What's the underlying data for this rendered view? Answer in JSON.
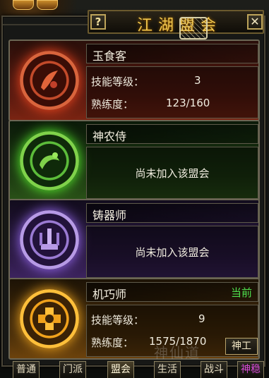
{
  "window": {
    "title": "江湖盟会",
    "help_label": "?",
    "close_label": "✕"
  },
  "guilds": [
    {
      "name": "玉食客",
      "theme": "red",
      "emblem_icon": "chef-emblem-icon",
      "joined": true,
      "level_label": "技能等级：",
      "level_value": "3",
      "prof_label": "熟练度：",
      "prof_value": "123/160"
    },
    {
      "name": "神农侍",
      "theme": "green",
      "emblem_icon": "herbalist-emblem-icon",
      "joined": false,
      "status": "尚未加入该盟会"
    },
    {
      "name": "铸器师",
      "theme": "purple",
      "emblem_icon": "smith-emblem-icon",
      "joined": false,
      "status": "尚未加入该盟会"
    },
    {
      "name": "机巧师",
      "theme": "orange",
      "emblem_icon": "mechanist-emblem-icon",
      "joined": true,
      "current_label": "当前",
      "level_label": "技能等级：",
      "level_value": "9",
      "prof_label": "熟练度：",
      "prof_value": "1575/1870",
      "skill_button": "神工"
    }
  ],
  "tabs": [
    "普通",
    "门派",
    "盟会",
    "生活",
    "战斗",
    "神稳"
  ],
  "active_tab": "盟会",
  "watermark": "神仙道",
  "colors": {
    "title": "#f2c84e",
    "current": "#4ee04e",
    "special_tab": "#d64ad6"
  }
}
